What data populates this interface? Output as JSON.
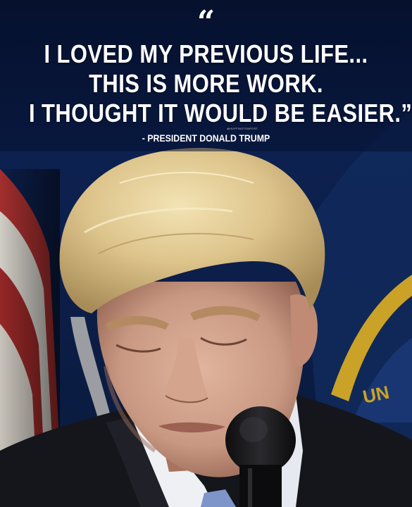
{
  "quote": {
    "mark": "“",
    "lines": [
      "I LOVED MY PREVIOUS LIFE...",
      "THIS IS MORE WORK.",
      "I THOUGHT IT WOULD BE EASIER.”"
    ],
    "attribution": "- PRESIDENT DONALD TRUMP",
    "watermark": "@HUFFINGTONPOST"
  },
  "colors": {
    "background_navy": "#0b1d44",
    "flag_red": "#9b2a2a",
    "flag_white": "#e8e4dc",
    "banner_gold": "#c9a227",
    "hair": "#e2c98f",
    "skin": "#c99882",
    "suit": "#15161b",
    "shirt": "#eef0f4",
    "tie": "#7d95c9",
    "text": "#ffffff"
  }
}
